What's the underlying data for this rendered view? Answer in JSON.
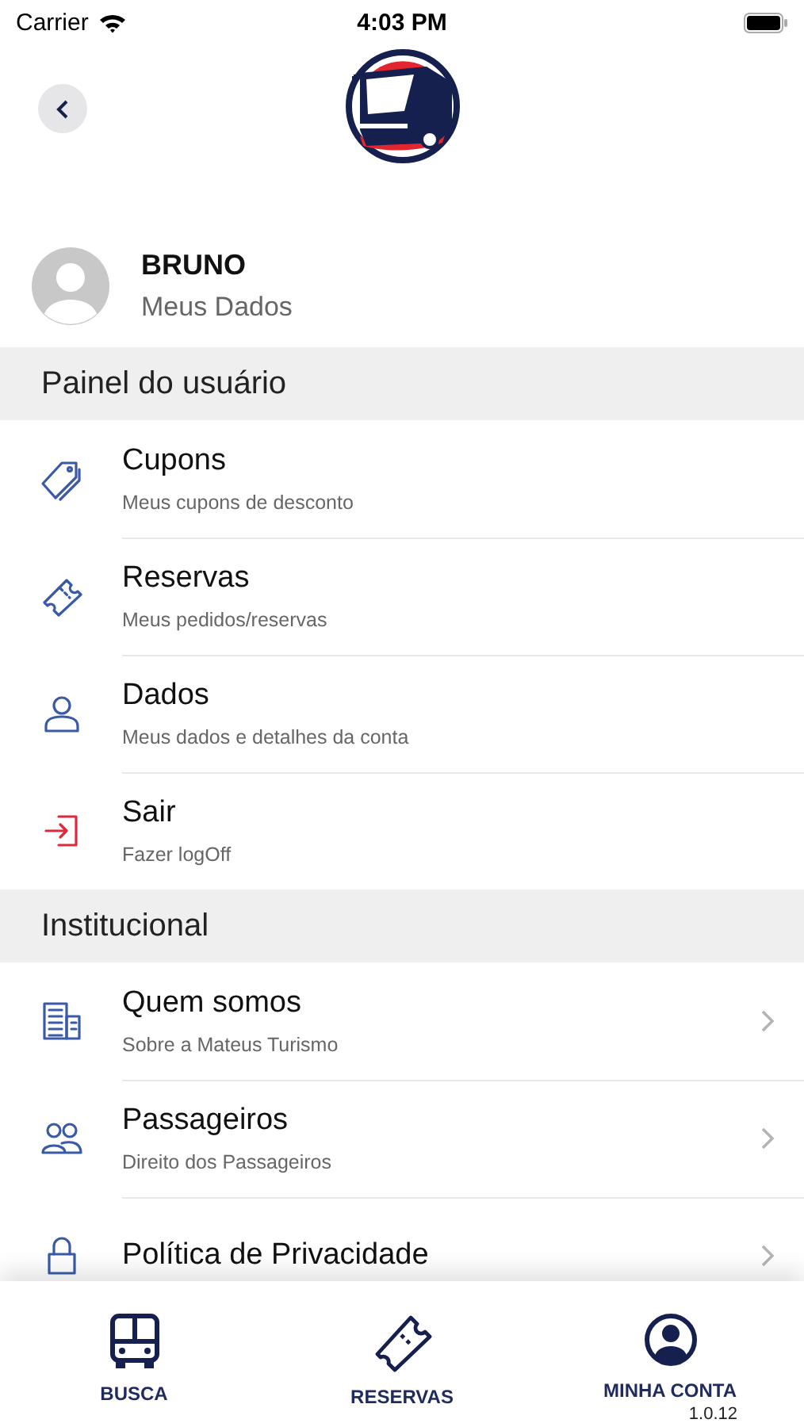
{
  "status_bar": {
    "carrier": "Carrier",
    "time": "4:03 PM"
  },
  "profile": {
    "name": "BRUNO",
    "subtitle": "Meus Dados"
  },
  "sections": [
    {
      "title": "Painel do usuário",
      "items": [
        {
          "title": "Cupons",
          "subtitle": "Meus cupons de desconto",
          "chevron": false
        },
        {
          "title": "Reservas",
          "subtitle": "Meus pedidos/reservas",
          "chevron": false
        },
        {
          "title": "Dados",
          "subtitle": "Meus dados e detalhes da conta",
          "chevron": false
        },
        {
          "title": "Sair",
          "subtitle": "Fazer logOff",
          "chevron": false
        }
      ]
    },
    {
      "title": "Institucional",
      "items": [
        {
          "title": "Quem somos",
          "subtitle": "Sobre a Mateus Turismo",
          "chevron": true
        },
        {
          "title": "Passageiros",
          "subtitle": "Direito dos Passageiros",
          "chevron": true
        },
        {
          "title": "Política de Privacidade",
          "chevron": true
        }
      ]
    }
  ],
  "tab_bar": [
    {
      "label": "BUSCA"
    },
    {
      "label": "RESERVAS"
    },
    {
      "label": "MINHA CONTA",
      "note": "1.0.12"
    }
  ]
}
